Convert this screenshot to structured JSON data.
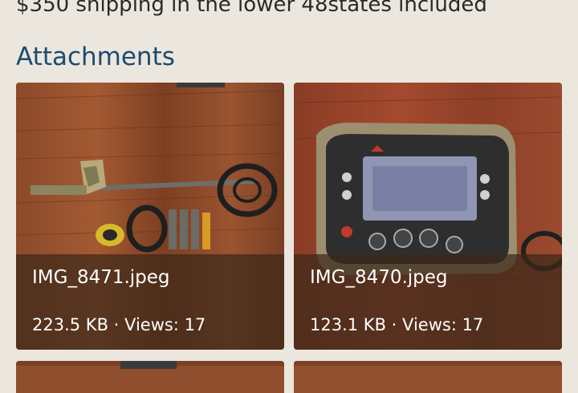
{
  "description_text": "$350 shipping in the lower 48states included",
  "attachments_heading": "Attachments",
  "attachments": [
    {
      "filename": "IMG_8471.jpeg",
      "size": "223.5 KB",
      "views": "Views: 17"
    },
    {
      "filename": "IMG_8470.jpeg",
      "size": "123.1 KB",
      "views": "Views: 17"
    }
  ],
  "separator": "·"
}
